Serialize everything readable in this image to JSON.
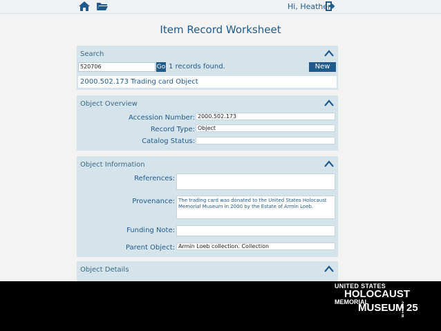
{
  "header": {
    "greeting": "Hi, Heather"
  },
  "page_title": "Item Record Worksheet",
  "search": {
    "heading": "Search",
    "input_value": "520706",
    "go_label": "Go",
    "records_found": "1 records found.",
    "new_label": "New",
    "result": "2000.502.173 Trading card Object"
  },
  "overview": {
    "heading": "Object Overview",
    "accession_label": "Accession Number:",
    "accession_value": "2000.502.173",
    "record_type_label": "Record Type:",
    "record_type_value": "Object",
    "catalog_status_label": "Catalog Status:",
    "catalog_status_value": ""
  },
  "information": {
    "heading": "Object Information",
    "references_label": "References:",
    "references_value": "",
    "provenance_label": "Provenance:",
    "provenance_value": "The trading card was donated to the United States Holocaust Memorial Museum in 2000 by the Estate of Armin Loeb.",
    "funding_label": "Funding Note:",
    "funding_value": "",
    "parent_label": "Parent Object:",
    "parent_value": "Armin Loeb collection. Collection"
  },
  "details": {
    "heading": "Object Details"
  },
  "logo": {
    "line1": "UNITED STATES",
    "line2": "HOLOCAUST",
    "line3": "MEMORIAL",
    "line4": "MUSEUM",
    "line5": "2018",
    "line6": "25"
  },
  "colors": {
    "accent": "#1f5a8c",
    "panel": "#d5e3eb",
    "background": "#f3f3f3"
  }
}
